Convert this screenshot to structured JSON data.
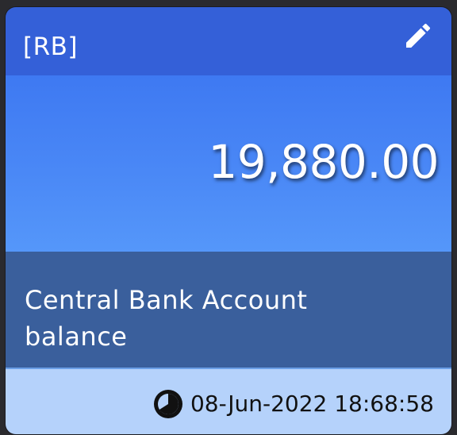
{
  "card": {
    "code": "[RB]",
    "value": "19,880.00",
    "description": "Central Bank Account balance",
    "timestamp": "08-Jun-2022 18:68:58"
  },
  "icons": {
    "edit": "pencil-icon",
    "clock": "clock-icon"
  },
  "colors": {
    "header": "#3460d8",
    "value_area": "#4a88f6",
    "description_area": "#3a5f9c",
    "footer": "#b5d2fb"
  }
}
